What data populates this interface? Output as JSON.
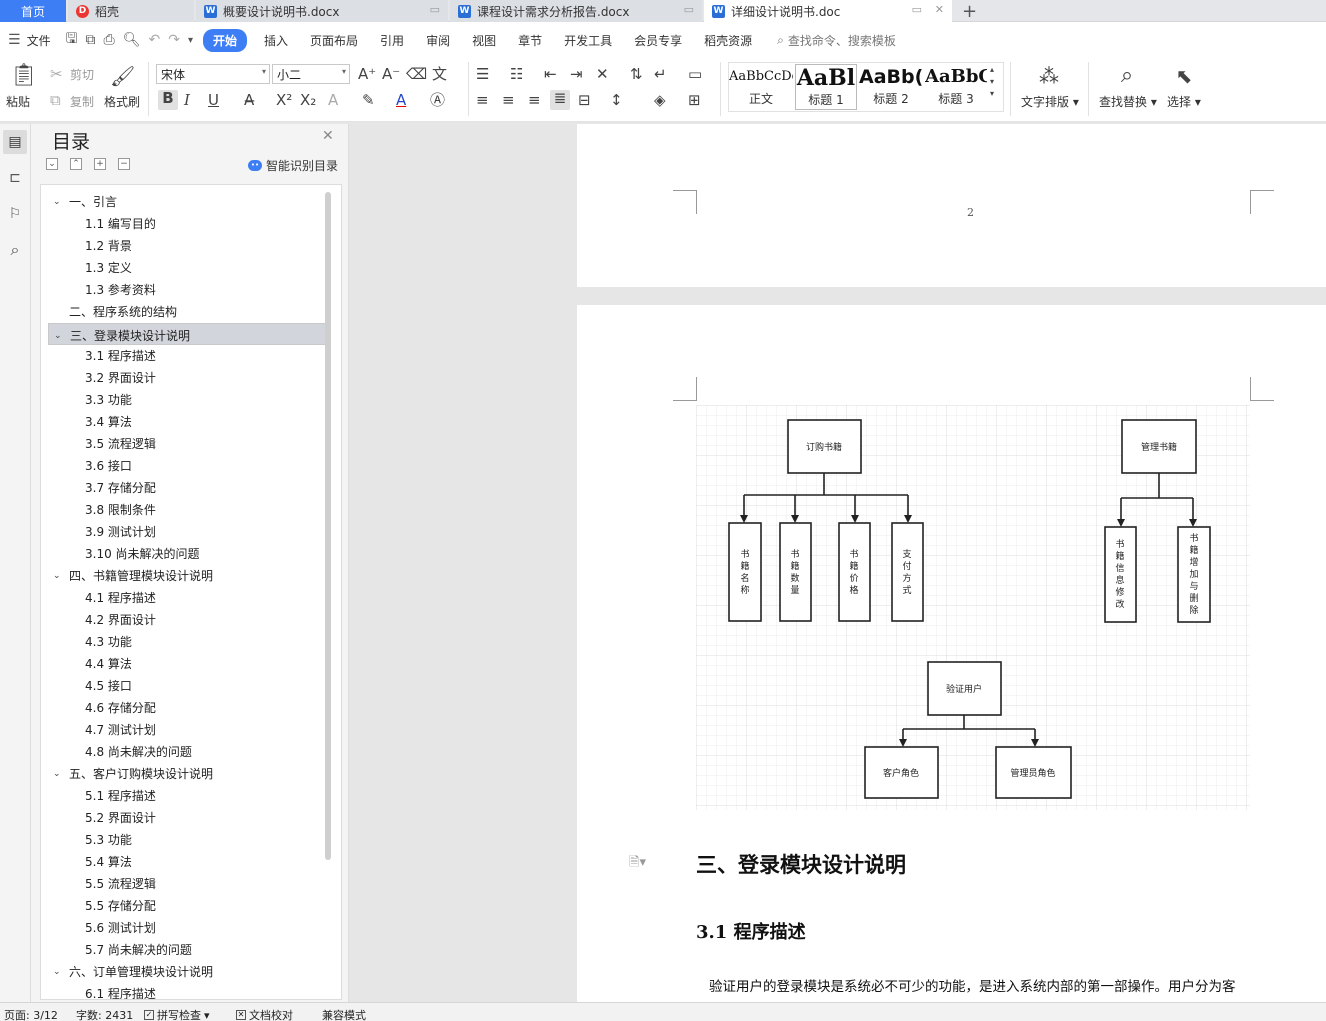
{
  "tabs": [
    {
      "label": "首页"
    },
    {
      "label": "稻壳"
    },
    {
      "label": "概要设计说明书.docx"
    },
    {
      "label": "课程设计需求分析报告.docx"
    },
    {
      "label": "详细设计说明书.doc"
    }
  ],
  "menu": {
    "file": "文件",
    "items": [
      "开始",
      "插入",
      "页面布局",
      "引用",
      "审阅",
      "视图",
      "章节",
      "开发工具",
      "会员专享",
      "稻壳资源"
    ],
    "search": "查找命令、搜索模板"
  },
  "ribbon": {
    "paste": "粘贴",
    "cut": "剪切",
    "copy": "复制",
    "format_painter": "格式刷",
    "font": "宋体",
    "font_size": "小二",
    "styles": [
      {
        "preview": "AaBbCcDd",
        "label": "正文"
      },
      {
        "preview": "AaBl",
        "label": "标题 1"
      },
      {
        "preview": "AaBb(",
        "label": "标题 2"
      },
      {
        "preview": "AaBbC",
        "label": "标题 3"
      }
    ],
    "text_layout": "文字排版",
    "find_replace": "查找替换",
    "select": "选择"
  },
  "toc": {
    "title": "目录",
    "smart": "智能识别目录",
    "items": [
      {
        "text": "一、引言",
        "level": 1,
        "expanded": true
      },
      {
        "text": "1.1 编写目的",
        "level": 2
      },
      {
        "text": "1.2 背景",
        "level": 2
      },
      {
        "text": "1.3 定义",
        "level": 2
      },
      {
        "text": "1.3 参考资料",
        "level": 2
      },
      {
        "text": "二、程序系统的结构",
        "level": 1
      },
      {
        "text": "三、登录模块设计说明",
        "level": 1,
        "expanded": true,
        "selected": true
      },
      {
        "text": "3.1 程序描述",
        "level": 2
      },
      {
        "text": "3.2 界面设计",
        "level": 2
      },
      {
        "text": "3.3 功能",
        "level": 2
      },
      {
        "text": "3.4 算法",
        "level": 2
      },
      {
        "text": "3.5 流程逻辑",
        "level": 2
      },
      {
        "text": "3.6 接口",
        "level": 2
      },
      {
        "text": "3.7 存储分配",
        "level": 2
      },
      {
        "text": "3.8 限制条件",
        "level": 2
      },
      {
        "text": "3.9 测试计划",
        "level": 2
      },
      {
        "text": "3.10 尚未解决的问题",
        "level": 2
      },
      {
        "text": "四、书籍管理模块设计说明",
        "level": 1,
        "expanded": true
      },
      {
        "text": "4.1 程序描述",
        "level": 2
      },
      {
        "text": "4.2 界面设计",
        "level": 2
      },
      {
        "text": "4.3 功能",
        "level": 2
      },
      {
        "text": "4.4 算法",
        "level": 2
      },
      {
        "text": "4.5 接口",
        "level": 2
      },
      {
        "text": "4.6 存储分配",
        "level": 2
      },
      {
        "text": "4.7 测试计划",
        "level": 2
      },
      {
        "text": "4.8 尚未解决的问题",
        "level": 2
      },
      {
        "text": "五、客户订购模块设计说明",
        "level": 1,
        "expanded": true
      },
      {
        "text": "5.1 程序描述",
        "level": 2
      },
      {
        "text": "5.2 界面设计",
        "level": 2
      },
      {
        "text": "5.3 功能",
        "level": 2
      },
      {
        "text": "5.4 算法",
        "level": 2
      },
      {
        "text": "5.5 流程逻辑",
        "level": 2
      },
      {
        "text": "5.5 存储分配",
        "level": 2
      },
      {
        "text": "5.6 测试计划",
        "level": 2
      },
      {
        "text": "5.7 尚未解决的问题",
        "level": 2
      },
      {
        "text": "六、订单管理模块设计说明",
        "level": 1,
        "expanded": true
      },
      {
        "text": "6.1 程序描述",
        "level": 2
      }
    ]
  },
  "document": {
    "page_number": "2",
    "diagram": {
      "order": "订购书籍",
      "order_children": [
        "书籍名称",
        "书籍数量",
        "书籍价格",
        "支付方式"
      ],
      "manage": "管理书籍",
      "manage_children": [
        "书籍信息修改",
        "书籍增加与删除"
      ],
      "verify": "验证用户",
      "verify_children": [
        "客户角色",
        "管理员角色"
      ]
    },
    "heading1": "三、登录模块设计说明",
    "heading2": "3.1 程序描述",
    "paragraph": "验证用户的登录模块是系统必不可少的功能，是进入系统内部的第一部操作。用户分为客"
  },
  "status": {
    "page": "页面: 3/12",
    "words": "字数: 2431",
    "spell": "拼写检查",
    "proof": "文档校对",
    "compat": "兼容模式"
  },
  "colors": {
    "accent": "#3e7ef5",
    "selected_row": "#d2d5db"
  }
}
